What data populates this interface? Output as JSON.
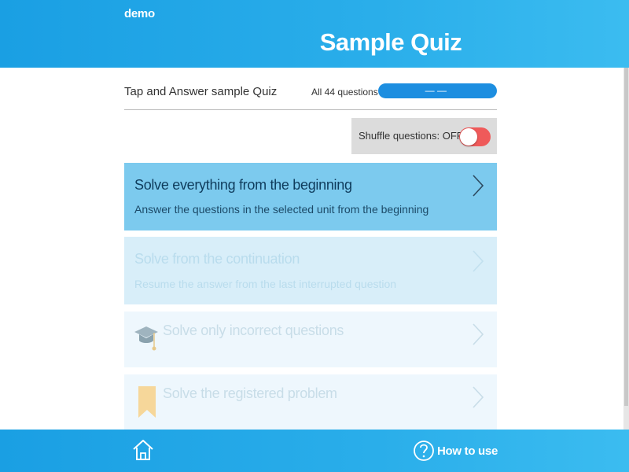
{
  "header": {
    "app_name": "demo",
    "title": "Sample Quiz"
  },
  "info": {
    "quiz_title": "Tap and Answer sample Quiz",
    "question_count": "All 44 questions",
    "progress_text": "— —"
  },
  "shuffle": {
    "label": "Shuffle questions: OFF",
    "state": "off",
    "toggle_color": "#ef5a5a"
  },
  "menu": [
    {
      "name": "Solve everything from the beginning",
      "desc": "Answer the questions in the selected unit from the beginning",
      "enabled": true
    },
    {
      "name": "Solve from the continuation",
      "desc": "Resume the answer from the last interrupted question",
      "enabled": false
    },
    {
      "name": "Solve only incorrect questions",
      "icon": "graduation-cap-icon",
      "enabled": false
    },
    {
      "name": "Solve the registered problem",
      "icon": "bookmark-icon",
      "enabled": false
    }
  ],
  "footer": {
    "home_icon": "home-icon",
    "help_label": "How to use",
    "help_icon": "question-circle-icon"
  },
  "colors": {
    "brand_blue": "#1a9fe3",
    "active_item": "#7ccaee",
    "disabled_item": "#d8eef9"
  }
}
